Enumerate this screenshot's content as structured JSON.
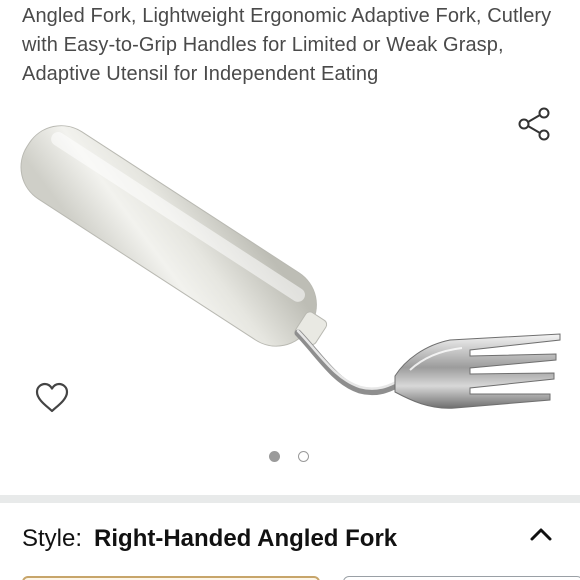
{
  "product": {
    "title": "Angled Fork, Lightweight Ergonomic Adaptive Fork, Cutlery with Easy-to-Grip Handles for Limited or Weak Grasp, Adaptive Utensil for Independent Eating"
  },
  "gallery": {
    "image_index": 1,
    "image_count": 2
  },
  "icons": {
    "share": "share-icon",
    "wishlist": "heart-outline-icon",
    "collapse": "chevron-up-icon"
  },
  "variation": {
    "label": "Style:",
    "value": "Right-Handed Angled Fork"
  },
  "colors": {
    "title_text": "#4a4a4a",
    "selected_option_border": "#c7a56a",
    "divider": "#e8eaea"
  }
}
